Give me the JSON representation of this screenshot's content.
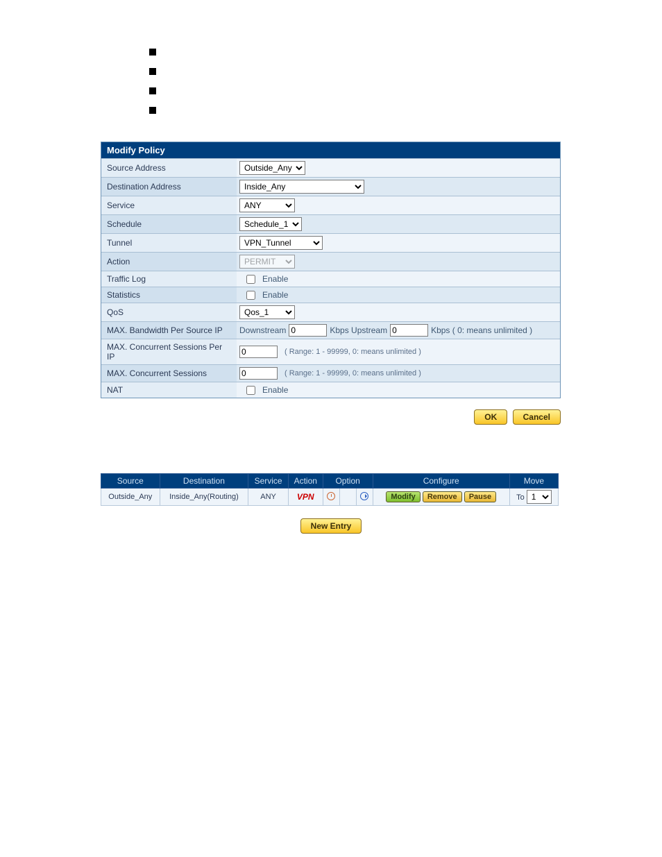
{
  "form": {
    "title": "Modify Policy",
    "rows": {
      "sourceAddress": {
        "label": "Source Address",
        "value": "Outside_Any"
      },
      "destAddress": {
        "label": "Destination Address",
        "value": "Inside_Any"
      },
      "service": {
        "label": "Service",
        "value": "ANY"
      },
      "schedule": {
        "label": "Schedule",
        "value": "Schedule_1"
      },
      "tunnel": {
        "label": "Tunnel",
        "value": "VPN_Tunnel"
      },
      "action": {
        "label": "Action",
        "value": "PERMIT"
      },
      "trafficLog": {
        "label": "Traffic Log",
        "checkboxLabel": "Enable"
      },
      "statistics": {
        "label": "Statistics",
        "checkboxLabel": "Enable"
      },
      "qos": {
        "label": "QoS",
        "value": "Qos_1"
      },
      "maxBw": {
        "label": "MAX. Bandwidth Per Source IP",
        "downLabel": "Downstream",
        "downValue": "0",
        "midLabel": "Kbps Upstream",
        "upValue": "0",
        "suffix": "Kbps ( 0: means unlimited )"
      },
      "maxSessPerIp": {
        "label": "MAX. Concurrent Sessions Per IP",
        "value": "0",
        "hint": "( Range: 1 - 99999, 0: means unlimited )"
      },
      "maxSess": {
        "label": "MAX. Concurrent Sessions",
        "value": "0",
        "hint": "( Range: 1 - 99999, 0: means unlimited )"
      },
      "nat": {
        "label": "NAT",
        "checkboxLabel": "Enable"
      }
    },
    "buttons": {
      "ok": "OK",
      "cancel": "Cancel"
    }
  },
  "table": {
    "headers": {
      "source": "Source",
      "destination": "Destination",
      "service": "Service",
      "action": "Action",
      "option": "Option",
      "configure": "Configure",
      "move": "Move"
    },
    "row": {
      "source": "Outside_Any",
      "destination": "Inside_Any(Routing)",
      "service": "ANY",
      "actionText": "VPN",
      "modify": "Modify",
      "remove": "Remove",
      "pause": "Pause",
      "moveTo": "To",
      "moveValue": "1"
    },
    "newEntry": "New Entry"
  }
}
